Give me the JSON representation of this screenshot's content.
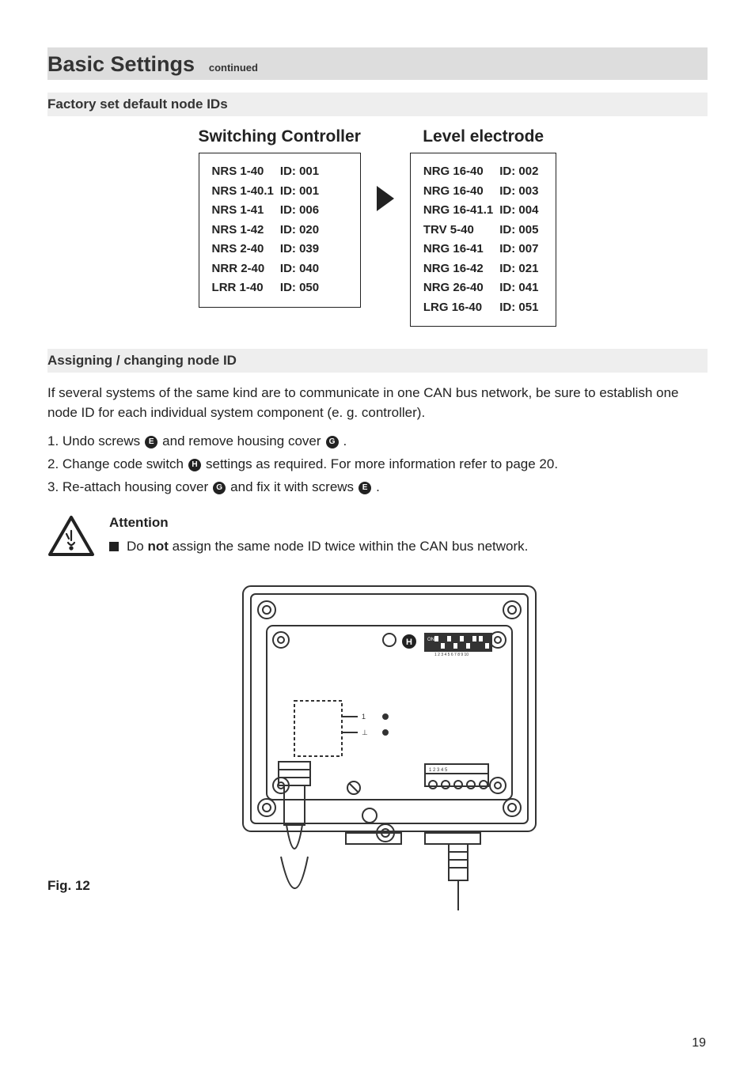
{
  "section": {
    "title": "Basic Settings",
    "continued": "continued"
  },
  "factory": {
    "heading": "Factory set default node IDs"
  },
  "controller": {
    "heading": "Switching Controller",
    "rows": [
      {
        "dev": "NRS 1-40",
        "id": "ID: 001"
      },
      {
        "dev": "NRS 1-40.1",
        "id": "ID: 001"
      },
      {
        "dev": "NRS 1-41",
        "id": "ID: 006"
      },
      {
        "dev": "NRS 1-42",
        "id": "ID: 020"
      },
      {
        "dev": "NRS 2-40",
        "id": "ID: 039"
      },
      {
        "dev": "NRR 2-40",
        "id": "ID: 040"
      },
      {
        "dev": "LRR 1-40",
        "id": "ID: 050"
      }
    ]
  },
  "electrode": {
    "heading": "Level electrode",
    "rows": [
      {
        "dev": "NRG 16-40",
        "id": "ID: 002"
      },
      {
        "dev": "NRG 16-40",
        "id": "ID: 003"
      },
      {
        "dev": "NRG 16-41.1",
        "id": "ID: 004"
      },
      {
        "dev": "TRV 5-40",
        "id": "ID: 005"
      },
      {
        "dev": "NRG 16-41",
        "id": "ID: 007"
      },
      {
        "dev": "NRG 16-42",
        "id": "ID: 021"
      },
      {
        "dev": "NRG 26-40",
        "id": "ID: 041"
      },
      {
        "dev": "LRG 16-40",
        "id": "ID: 051"
      }
    ]
  },
  "assign": {
    "heading": "Assigning / changing node ID",
    "intro": "If several systems of the same kind are to communicate in one CAN bus network, be sure to establish one node ID for each individual system component (e. g. controller).",
    "step1_a": "1.  Undo screws ",
    "step1_b": " and remove housing cover ",
    "step1_c": ".",
    "step2_a": "2.  Change code switch ",
    "step2_b": " settings as required. For more information refer to page 20.",
    "step3_a": "3.  Re-attach housing cover ",
    "step3_b": " and fix it with screws ",
    "step3_c": ".",
    "refE": "E",
    "refG": "G",
    "refH": "H"
  },
  "attention": {
    "title": "Attention",
    "text_a": "Do ",
    "text_bold": "not",
    "text_b": " assign the same node ID twice within the CAN bus network."
  },
  "figure": {
    "caption": "Fig. 12",
    "refH": "H",
    "dip_on": "ON"
  },
  "page_number": "19"
}
